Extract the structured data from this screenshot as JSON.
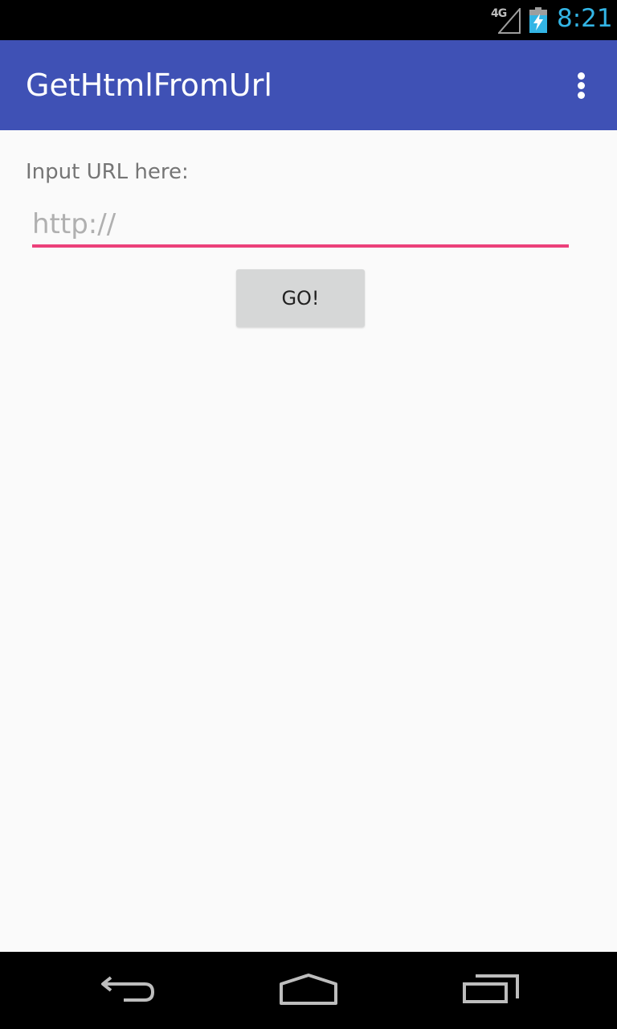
{
  "status_bar": {
    "network": "4G",
    "time": "8:21",
    "icons": [
      "signal-icon",
      "battery-charging-icon"
    ]
  },
  "app_bar": {
    "title": "GetHtmlFromUrl",
    "overflow_icon": "more-vert-icon"
  },
  "form": {
    "label": "Input URL here:",
    "input_placeholder": "http://",
    "input_value": "",
    "go_label": "GO!"
  },
  "nav_bar": {
    "icons": [
      "back-icon",
      "home-icon",
      "recents-icon"
    ]
  },
  "colors": {
    "app_bar": "#3f51b5",
    "accent": "#ec407a",
    "clock": "#33b5e5",
    "button": "#d6d7d7",
    "background": "#fafafa"
  }
}
